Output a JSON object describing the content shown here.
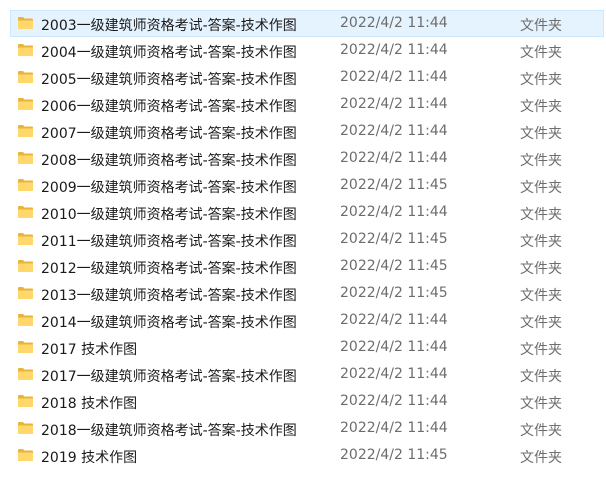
{
  "icon": "folder-icon",
  "colors": {
    "folder_front": "#ffd76a",
    "folder_back": "#e8b53a",
    "selected_bg": "#e5f3ff",
    "selected_border": "#cce8ff",
    "name_text": "#1a1a1a",
    "meta_text": "#6d6d6d"
  },
  "rows": [
    {
      "name": "2003一级建筑师资格考试-答案-技术作图",
      "date": "2022/4/2 11:44",
      "type": "文件夹",
      "selected": true
    },
    {
      "name": "2004一级建筑师资格考试-答案-技术作图",
      "date": "2022/4/2 11:44",
      "type": "文件夹"
    },
    {
      "name": "2005一级建筑师资格考试-答案-技术作图",
      "date": "2022/4/2 11:44",
      "type": "文件夹"
    },
    {
      "name": "2006一级建筑师资格考试-答案-技术作图",
      "date": "2022/4/2 11:44",
      "type": "文件夹"
    },
    {
      "name": "2007一级建筑师资格考试-答案-技术作图",
      "date": "2022/4/2 11:44",
      "type": "文件夹"
    },
    {
      "name": "2008一级建筑师资格考试-答案-技术作图",
      "date": "2022/4/2 11:44",
      "type": "文件夹"
    },
    {
      "name": "2009一级建筑师资格考试-答案-技术作图",
      "date": "2022/4/2 11:45",
      "type": "文件夹"
    },
    {
      "name": "2010一级建筑师资格考试-答案-技术作图",
      "date": "2022/4/2 11:44",
      "type": "文件夹"
    },
    {
      "name": "2011一级建筑师资格考试-答案-技术作图",
      "date": "2022/4/2 11:45",
      "type": "文件夹"
    },
    {
      "name": "2012一级建筑师资格考试-答案-技术作图",
      "date": "2022/4/2 11:45",
      "type": "文件夹"
    },
    {
      "name": "2013一级建筑师资格考试-答案-技术作图",
      "date": "2022/4/2 11:45",
      "type": "文件夹"
    },
    {
      "name": "2014一级建筑师资格考试-答案-技术作图",
      "date": "2022/4/2 11:44",
      "type": "文件夹"
    },
    {
      "name": "2017 技术作图",
      "date": "2022/4/2 11:44",
      "type": "文件夹"
    },
    {
      "name": "2017一级建筑师资格考试-答案-技术作图",
      "date": "2022/4/2 11:44",
      "type": "文件夹"
    },
    {
      "name": "2018 技术作图",
      "date": "2022/4/2 11:44",
      "type": "文件夹"
    },
    {
      "name": "2018一级建筑师资格考试-答案-技术作图",
      "date": "2022/4/2 11:44",
      "type": "文件夹"
    },
    {
      "name": "2019 技术作图",
      "date": "2022/4/2 11:45",
      "type": "文件夹"
    }
  ]
}
